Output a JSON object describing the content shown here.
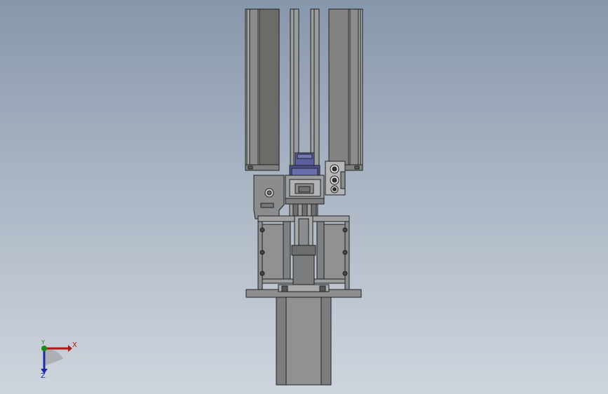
{
  "viewport": {
    "background_top": "#8797ab",
    "background_bottom": "#cfd5dd"
  },
  "model": {
    "colors": {
      "frame": "#8a8c8e",
      "frame_dark": "#6b6b68",
      "frame_light": "#a3a5a7",
      "edge": "#222222",
      "motor_blue": "#5a5e9c",
      "motor_blue_light": "#7478b8",
      "motor_body": "#8f9193"
    }
  },
  "triad": {
    "x_label": "X",
    "y_label": "Y",
    "z_label": "Z",
    "x_color": "#b01818",
    "y_color": "#1a8a1a",
    "z_color": "#1a2aa8"
  }
}
